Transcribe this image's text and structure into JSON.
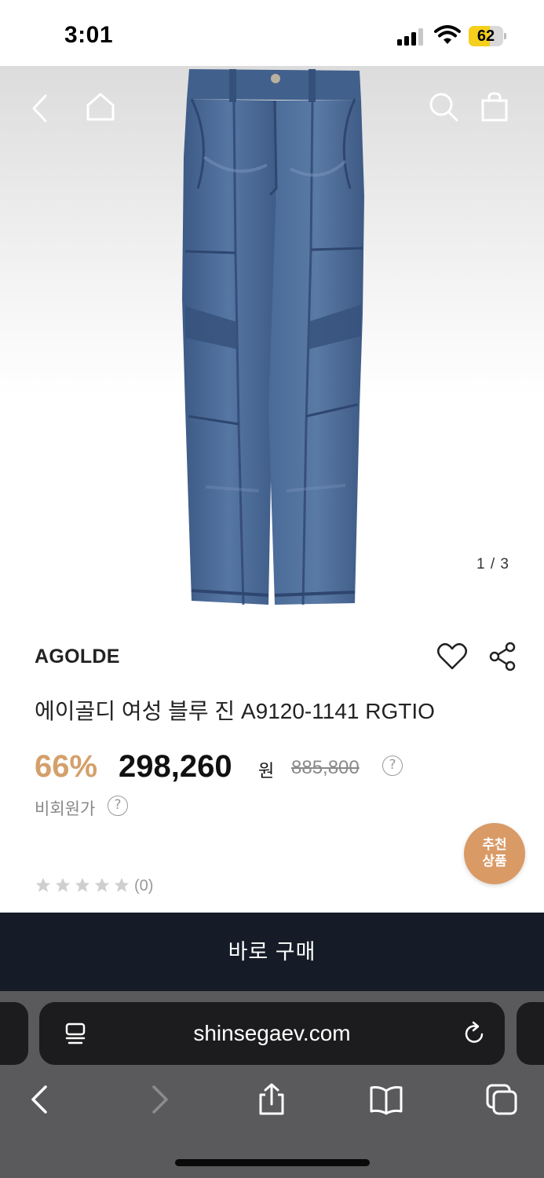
{
  "status_bar": {
    "time": "3:01",
    "battery_level": "62",
    "battery_fraction": 0.62,
    "signal_bars_active": 3,
    "signal_bars_total": 4
  },
  "header": {
    "icons": [
      "back-icon",
      "home-icon",
      "search-icon",
      "shopping-bag-icon"
    ]
  },
  "gallery": {
    "counter": "1 / 3"
  },
  "product": {
    "brand": "AGOLDE",
    "name": "에이골디 여성 블루 진 A9120-1141 RGTIO",
    "discount": "66%",
    "price": "298,260",
    "currency": "원",
    "original_price": "885,800",
    "member_price_label": "비회원가",
    "help_mark": "?",
    "rating_count": "(0)",
    "rating_stars": 0
  },
  "recommend_badge": {
    "line1": "추천",
    "line2": "상품"
  },
  "buy_button": {
    "label": "바로 구매"
  },
  "browser": {
    "url": "shinsegaev.com",
    "toolbar": [
      "back-icon",
      "forward-icon",
      "share-icon",
      "bookmarks-icon",
      "tabs-icon"
    ]
  },
  "colors": {
    "accent_discount": "#d4a06c",
    "badge": "#d99a66",
    "buy_bar": "#151c28",
    "denim": "#4a6690"
  }
}
